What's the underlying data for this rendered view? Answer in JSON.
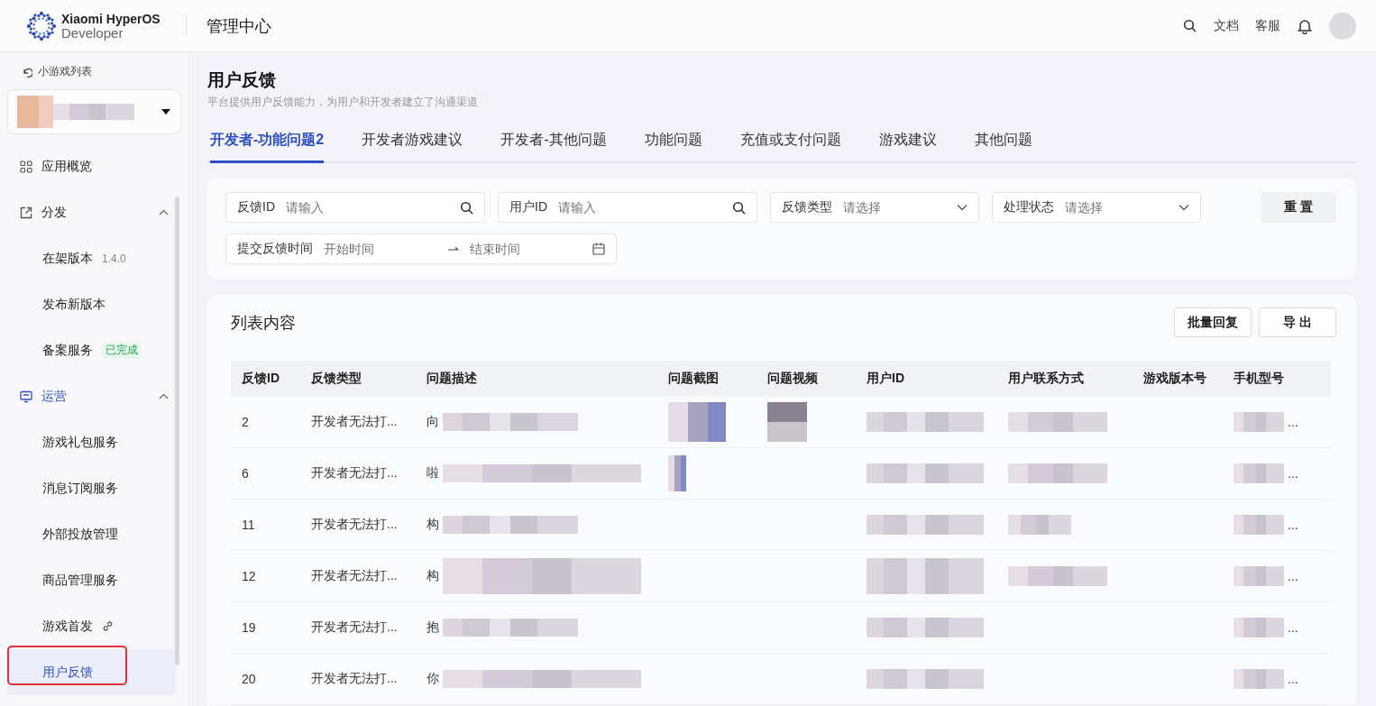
{
  "header": {
    "brand_name": "Xiaomi HyperOS",
    "brand_sub": "Developer",
    "section": "管理中心",
    "links": [
      "文档",
      "客服"
    ]
  },
  "sidebar": {
    "back": "小游戏列表",
    "groups": [
      {
        "label": "应用概览"
      },
      {
        "label": "分发",
        "expanded": true,
        "children": [
          {
            "kind": "version",
            "label": "在架版本",
            "badge": "1.4.0",
            "selected": false,
            "marked": false
          },
          {
            "kind": "plain",
            "label": "发布新版本",
            "selected": false,
            "marked": false
          },
          {
            "kind": "status",
            "label": "备案服务",
            "badge": "已完成",
            "selected": false,
            "marked": false
          }
        ]
      },
      {
        "label": "运营",
        "expanded": true,
        "children": [
          {
            "kind": "plain",
            "label": "游戏礼包服务",
            "selected": false,
            "marked": false
          },
          {
            "kind": "plain",
            "label": "消息订阅服务",
            "selected": false,
            "marked": false
          },
          {
            "kind": "plain",
            "label": "外部投放管理",
            "selected": false,
            "marked": false
          },
          {
            "kind": "plain",
            "label": "商品管理服务",
            "selected": false,
            "marked": false
          },
          {
            "kind": "link",
            "label": "游戏首发",
            "selected": false,
            "marked": false
          },
          {
            "kind": "plain",
            "label": "用户反馈",
            "selected": true,
            "marked": true
          }
        ]
      }
    ]
  },
  "page": {
    "title": "用户反馈",
    "subtitle": "平台提供用户反馈能力，为用户和开发者建立了沟通渠道",
    "tabs": [
      {
        "label": "开发者-功能问题2",
        "selected": true
      },
      {
        "label": "开发者游戏建议",
        "selected": false
      },
      {
        "label": "开发者-其他问题",
        "selected": false
      },
      {
        "label": "功能问题",
        "selected": false
      },
      {
        "label": "充值或支付问题",
        "selected": false
      },
      {
        "label": "游戏建议",
        "selected": false
      },
      {
        "label": "其他问题",
        "selected": false
      }
    ],
    "filters": [
      {
        "kind": "search",
        "label": "反馈ID",
        "placeholder": "请输入"
      },
      {
        "kind": "search",
        "label": "用户ID",
        "placeholder": "请输入"
      },
      {
        "kind": "select",
        "label": "反馈类型",
        "placeholder": "请选择"
      },
      {
        "kind": "select",
        "label": "处理状态",
        "placeholder": "请选择"
      }
    ],
    "reset_button": "重 置",
    "date_range": {
      "label": "提交反馈时间",
      "start_placeholder": "开始时间",
      "end_placeholder": "结束时间"
    },
    "list": {
      "title": "列表内容",
      "buttons": [
        "批量回复",
        "导 出"
      ],
      "columns": [
        "反馈ID",
        "反馈类型",
        "问题描述",
        "问题截图",
        "问题视频",
        "用户ID",
        "用户联系方式",
        "游戏版本号",
        "手机型号"
      ],
      "rows": [
        {
          "id": "2",
          "type": "开发者无法打...",
          "description": "向",
          "has_screenshot": true,
          "has_video": true,
          "phone": "..."
        },
        {
          "id": "6",
          "type": "开发者无法打...",
          "description": "啦",
          "has_screenshot": true,
          "has_video": false,
          "phone": "..."
        },
        {
          "id": "11",
          "type": "开发者无法打...",
          "description": "构",
          "has_screenshot": false,
          "has_video": false,
          "phone": "..."
        },
        {
          "id": "12",
          "type": "开发者无法打...",
          "description": "构",
          "has_screenshot": false,
          "has_video": false,
          "phone": "..."
        },
        {
          "id": "19",
          "type": "开发者无法打...",
          "description": "抱",
          "has_screenshot": false,
          "has_video": false,
          "phone": "..."
        },
        {
          "id": "20",
          "type": "开发者无法打...",
          "description": "你",
          "has_screenshot": false,
          "has_video": false,
          "phone": "..."
        }
      ]
    }
  }
}
